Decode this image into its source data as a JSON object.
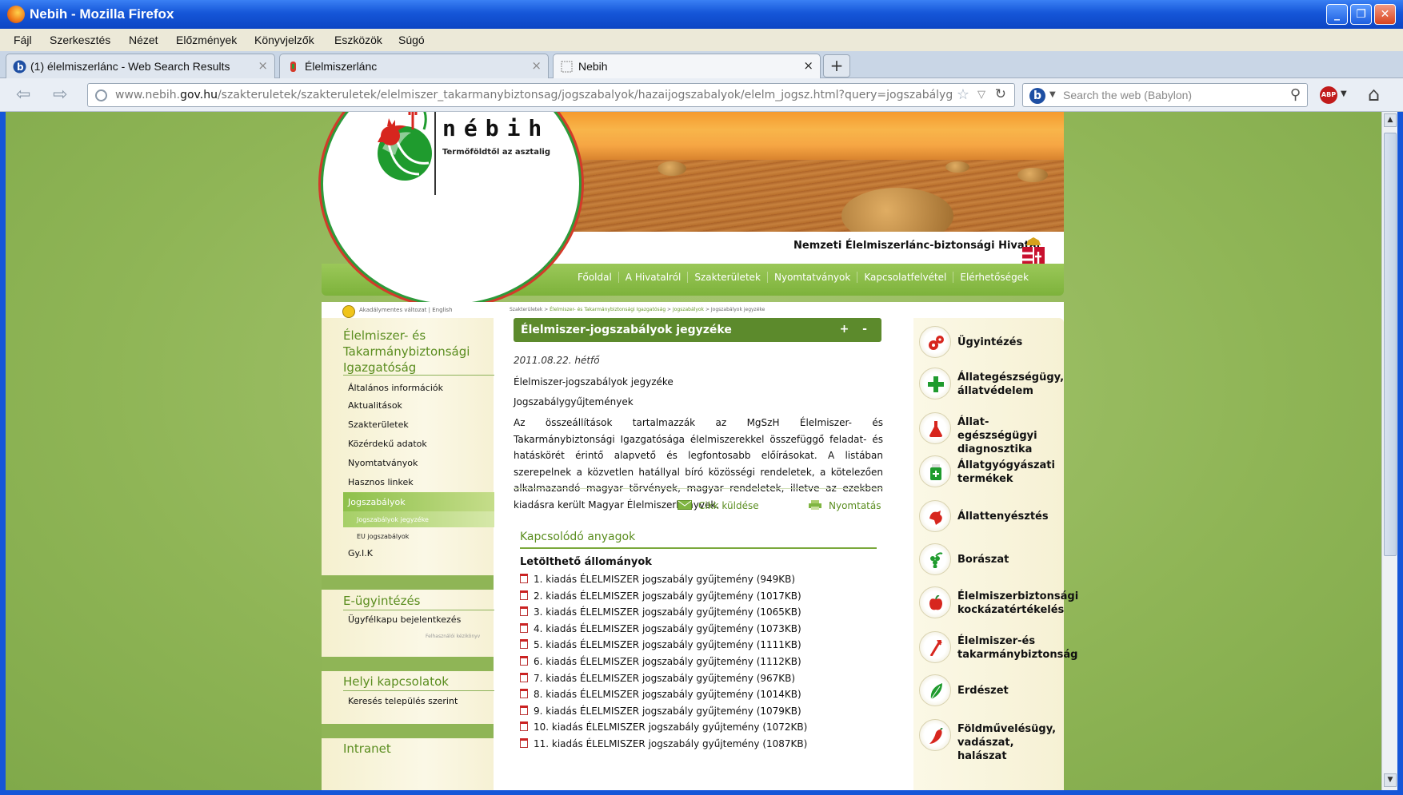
{
  "window": {
    "title": "Nebih - Mozilla Firefox",
    "buttons": [
      "_",
      "❐",
      "✕"
    ]
  },
  "menu": [
    "Fájl",
    "Szerkesztés",
    "Nézet",
    "Előzmények",
    "Könyvjelzők",
    "Eszközök",
    "Súgó"
  ],
  "tabs": [
    {
      "label": "(1) élelmiszerlánc - Web Search Results",
      "close": "×"
    },
    {
      "label": "Élelmiszerlánc",
      "close": "×"
    },
    {
      "label": "Nebih",
      "close": "×"
    }
  ],
  "newtab": "+",
  "nav": {
    "back": "⇦",
    "forward": "⇨",
    "url_prefix": "www.nebih.",
    "url_domain": "gov.hu",
    "url_path": "/szakteruletek/szakteruletek/elelmiszer_takarmanybiztonsag/jogszabalyok/hazaijogszabalyok/elelm_jogsz.html?query=jogszabálygyűjtemén",
    "search_placeholder": "Search the web (Babylon)",
    "abp": "ABP"
  },
  "site": {
    "brand": "nébih",
    "slogan": "Termőföldtől az asztalig",
    "agency": "Nemzeti Élelmiszerlánc-biztonsági Hivatal",
    "topnav": [
      "Főoldal",
      "A Hivatalról",
      "Szakterületek",
      "Nyomtatványok",
      "Kapcsolatfelvétel",
      "Elérhetőségek"
    ],
    "accessibility": "Akadálymentes változat  |  English",
    "breadcrumb": [
      "Szakterületek",
      " > ",
      "Élelmiszer- és Takarmánybiztonsági Igazgatóság",
      " > ",
      "Jogszabályok",
      " > ",
      "Jogszabályok jegyzéke"
    ]
  },
  "sidebar": {
    "section1_title": "Élelmiszer- és Takarmánybiztonsági Igazgatóság",
    "items": [
      "Általános információk",
      "Aktualitások",
      "Szakterületek",
      "Közérdekű adatok",
      "Nyomtatványok",
      "Hasznos linkek",
      "Jogszabályok",
      "Gy.I.K"
    ],
    "subitems": [
      "Jogszabályok jegyzéke",
      "EU jogszabályok"
    ],
    "section2_title": "E-ügyintézés",
    "section2_item": "Ügyfélkapu bejelentkezés",
    "section2_small": "Felhasználói kézikönyv",
    "section3_title": "Helyi kapcsolatok",
    "section3_item": "Keresés település szerint",
    "section4_title": "Intranet"
  },
  "main": {
    "heading": "Élelmiszer-jogszabályok jegyzéke",
    "heading_controls": "+ -",
    "date": "2011.08.22. hétfő",
    "subtitle1": "Élelmiszer-jogszabályok jegyzéke",
    "subtitle2": "Jogszabálygyűjtemények",
    "body": "Az összeállítások tartalmazzák az MgSzH Élelmiszer- és Takarmánybiztonsági Igazgatósága élelmiszerekkel összefüggő feladat- és hatáskörét érintő alapvető és legfontosabb előírásokat. A listában szerepelnek a közvetlen hatállyal bíró közösségi rendeletek, a kötelezően alkalmazandó magyar törvények, magyar rendeletek, illetve az ezekben kiadásra került Magyar Élelmiszerkönyvek.",
    "send_label": "Cikk küldése",
    "print_label": "Nyomtatás",
    "related_title": "Kapcsolódó anyagok",
    "downloads_title": "Letölthető állományok",
    "downloads": [
      "1. kiadás ÉLELMISZER jogszabály gyűjtemény (949KB)",
      "2. kiadás ÉLELMISZER jogszabály gyűjtemény (1017KB)",
      "3. kiadás ÉLELMISZER jogszabály gyűjtemény (1065KB)",
      "4. kiadás ÉLELMISZER jogszabály gyűjtemény (1073KB)",
      "5. kiadás ÉLELMISZER jogszabály gyűjtemény (1111KB)",
      "6. kiadás ÉLELMISZER jogszabály gyűjtemény (1112KB)",
      "7. kiadás ÉLELMISZER jogszabály gyűjtemény (967KB)",
      "8. kiadás ÉLELMISZER jogszabály gyűjtemény (1014KB)",
      "9. kiadás ÉLELMISZER jogszabály gyűjtemény (1079KB)",
      "10. kiadás ÉLELMISZER jogszabály gyűjtemény (1072KB)",
      "11. kiadás ÉLELMISZER jogszabály gyűjtemény (1087KB)"
    ]
  },
  "categories": [
    {
      "label": "Ügyintézés",
      "icon": "gears-icon",
      "color": "#d7261e"
    },
    {
      "label": "Állategészségügy, állatvédelem",
      "icon": "green-cross-icon",
      "color": "#1f9b2e"
    },
    {
      "label": "Állat-egészségügyi diagnosztika",
      "icon": "flask-icon",
      "color": "#d7261e"
    },
    {
      "label": "Állatgyógyászati termékek",
      "icon": "medicine-bottle-icon",
      "color": "#1f9b2e"
    },
    {
      "label": "Állattenyésztés",
      "icon": "rooster-icon",
      "color": "#d7261e"
    },
    {
      "label": "Borászat",
      "icon": "grapes-icon",
      "color": "#1f9b2e"
    },
    {
      "label": "Élelmiszerbiztonsági kockázatértékelés",
      "icon": "apple-icon",
      "color": "#d7261e"
    },
    {
      "label": "Élelmiszer-és takarmánybiztonság",
      "icon": "fork-icon",
      "color": "#d7261e"
    },
    {
      "label": "Erdészet",
      "icon": "leaf-icon",
      "color": "#1f9b2e"
    },
    {
      "label": "Földművelésügy, vadászat, halászat",
      "icon": "pepper-icon",
      "color": "#d7261e"
    }
  ],
  "scroll": {
    "up": "▲",
    "down": "▼"
  }
}
